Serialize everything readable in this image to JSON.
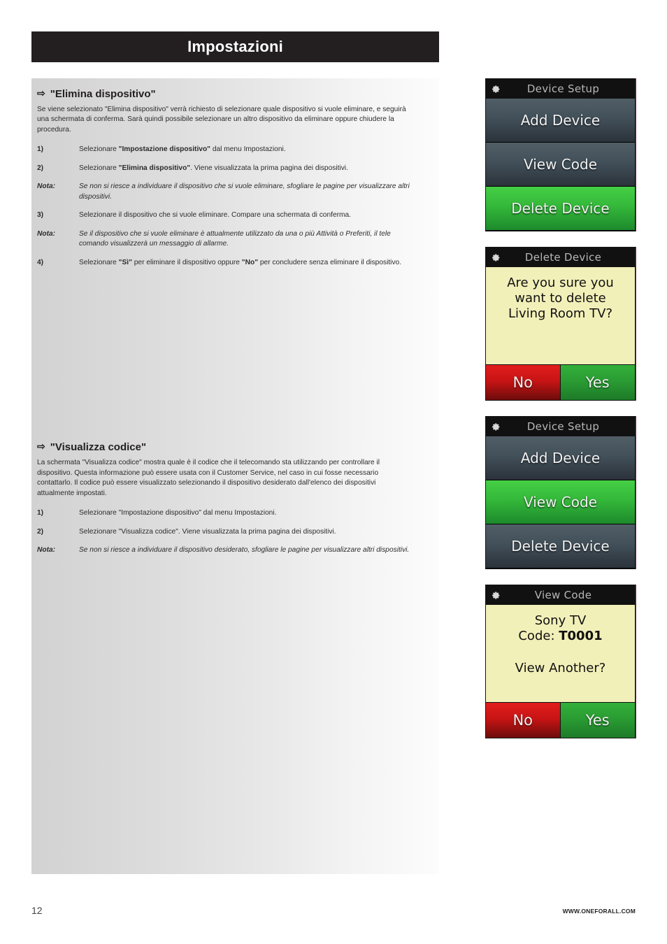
{
  "header": {
    "title": "Impostazioni"
  },
  "sections": [
    {
      "bullet": "⇨",
      "heading": "\"Elimina dispositivo\"",
      "intro": "Se viene selezionato \"Elimina dispositivo\" verrà richiesto di selezionare quale dispositivo si vuole eliminare, e seguirà una schermata di conferma. Sarà quindi possibile selezionare un altro dispositivo da eliminare oppure chiudere la procedura.",
      "items": [
        {
          "kind": "step",
          "label": "1)",
          "text_html": "Selezionare <b>\"Impostazione dispositivo\"</b> dal menu Impostazioni."
        },
        {
          "kind": "step",
          "label": "2)",
          "text_html": "Selezionare <b>\"Elimina dispositivo\"</b>. Viene visualizzata la prima pagina dei dispositivi."
        },
        {
          "kind": "note",
          "label": "Nota:",
          "text_html": "Se non si riesce a individuare il dispositivo che si vuole eliminare, sfogliare le pagine per visualizzare altri dispositivi."
        },
        {
          "kind": "step",
          "label": "3)",
          "text_html": "Selezionare il dispositivo che si vuole eliminare. Compare una schermata di conferma."
        },
        {
          "kind": "note",
          "label": "Nota:",
          "text_html": "Se il dispositivo che si vuole eliminare è attualmente utilizzato da una o più Attività o Preferiti, il tele comando visualizzerà un messaggio di allarme."
        },
        {
          "kind": "step",
          "label": "4)",
          "text_html": "Selezionare <b>\"Sì\"</b> per eliminare il dispositivo oppure <b>\"No\"</b> per concludere senza eliminare il dispositivo."
        }
      ]
    },
    {
      "bullet": "⇨",
      "heading": "\"Visualizza codice\"",
      "intro": "La schermata \"Visualizza codice\" mostra quale è il codice che il telecomando sta utilizzando per controllare il dispositivo. Questa informazione può essere usata con il Customer Service, nel caso in cui fosse necessario contattarlo. Il codice può essere visualizzato selezionando il dispositivo desiderato dall'elenco dei dispositivi attualmente impostati.",
      "items": [
        {
          "kind": "step",
          "label": "1)",
          "text_html": "Selezionare \"Impostazione dispositivo\" dal menu Impostazioni."
        },
        {
          "kind": "step",
          "label": "2)",
          "text_html": "Selezionare \"Visualizza codice\". Viene visualizzata la prima pagina dei dispositivi."
        },
        {
          "kind": "note",
          "label": "Nota:",
          "text_html": "Se non si riesce a individuare il dispositivo desiderato, sfogliare le pagine per visualizzare altri dispositivi."
        }
      ]
    }
  ],
  "device_screens": [
    {
      "id": "device-setup-delete-highlighted",
      "icon": "gear-icon",
      "title": "Device Setup",
      "type": "menu",
      "menu_items": [
        {
          "label": "Add Device",
          "state": "normal"
        },
        {
          "label": "View Code",
          "state": "normal"
        },
        {
          "label": "Delete Device",
          "state": "highlighted"
        }
      ]
    },
    {
      "id": "delete-device-confirm",
      "icon": "gear-icon",
      "title": "Delete Device",
      "type": "confirm",
      "body_lines": [
        "Are you sure you",
        "want to delete",
        "Living Room TV?"
      ],
      "buttons": [
        {
          "label": "No",
          "style": "no"
        },
        {
          "label": "Yes",
          "style": "yes"
        }
      ]
    },
    {
      "id": "device-setup-viewcode-highlighted",
      "icon": "gear-icon",
      "title": "Device Setup",
      "type": "menu",
      "menu_items": [
        {
          "label": "Add Device",
          "state": "normal"
        },
        {
          "label": "View Code",
          "state": "highlighted"
        },
        {
          "label": "Delete Device",
          "state": "normal"
        }
      ]
    },
    {
      "id": "view-code-result",
      "icon": "gear-icon",
      "title": "View Code",
      "type": "code",
      "device_name": "Sony TV",
      "code_label": "Code:",
      "code_value": "T0001",
      "prompt": "View Another?",
      "buttons": [
        {
          "label": "No",
          "style": "no"
        },
        {
          "label": "Yes",
          "style": "yes"
        }
      ]
    }
  ],
  "footer": {
    "page_number": "12",
    "website": "WWW.ONEFORALL.COM"
  },
  "colors": {
    "header_bar": "#231f20",
    "highlight_green": "#34b83a",
    "button_no_red": "#c81414",
    "button_yes_green": "#2a9c33",
    "screen_body_yellow": "#f2f0b9",
    "menu_dark_slate": "#42505a"
  }
}
